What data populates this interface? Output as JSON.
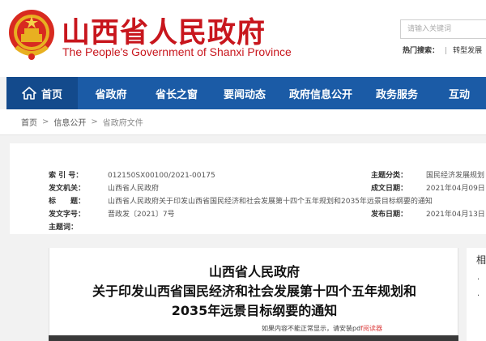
{
  "header": {
    "title": "山西省人民政府",
    "subtitle": "The People's Government of Shanxi Province",
    "search_placeholder": "请输入关键词",
    "hot_label": "热门搜索：",
    "hot_items": [
      "转型发展"
    ]
  },
  "nav": {
    "items": [
      "首页",
      "省政府",
      "省长之窗",
      "要闻动态",
      "政府信息公开",
      "政务服务",
      "互动"
    ]
  },
  "breadcrumb": {
    "items": [
      "首页",
      "信息公开",
      "省政府文件"
    ],
    "separator": ">"
  },
  "meta": {
    "index_label": "索 引 号：",
    "index_value": "012150SX00100/2021-00175",
    "issuer_label": "发文机关：",
    "issuer_value": "山西省人民政府",
    "title_label": "标　　题：",
    "title_value": "山西省人民政府关于印发山西省国民经济和社会发展第十四个五年规划和2035年远景目标纲要的通知",
    "docno_label": "发文字号：",
    "docno_value": "晋政发〔2021〕7号",
    "theme_label": "主题词：",
    "theme_value": "",
    "category_label": "主题分类：",
    "category_value": "国民经济发展规划",
    "created_label": "成文日期：",
    "created_value": "2021年04月09日",
    "published_label": "发布日期：",
    "published_value": "2021年04月13日"
  },
  "document": {
    "title_line1": "山西省人民政府",
    "title_line2": "关于印发山西省国民经济和社会发展第十四个五年规划和",
    "title_line3": "2035年远景目标纲要的通知",
    "pdf_note": "如果内容不能正常显示，请安装pd",
    "pdf_link": "f阅读器"
  },
  "side": {
    "text": "相",
    "dot1": "·",
    "dot2": "·"
  },
  "colors": {
    "brand_red": "#c8161d",
    "nav_blue": "#1b5ba6",
    "nav_active": "#134a8c"
  }
}
